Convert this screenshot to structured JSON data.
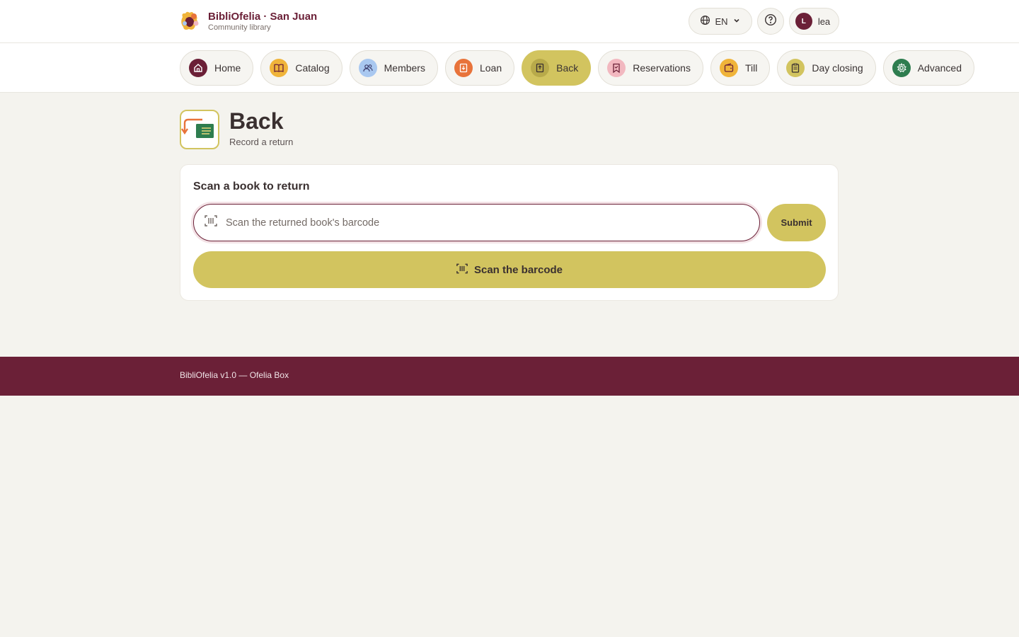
{
  "header": {
    "brand_title": "BibliOfelia · San Juan",
    "brand_subtitle": "Community library",
    "language": "EN",
    "user_initial": "L",
    "user_name": "lea"
  },
  "nav": {
    "items": [
      {
        "label": "Home",
        "icon": "home-icon",
        "color": "#6b2037"
      },
      {
        "label": "Catalog",
        "icon": "book-icon",
        "color": "#f0b43a"
      },
      {
        "label": "Members",
        "icon": "users-icon",
        "color": "#a9c8f0"
      },
      {
        "label": "Loan",
        "icon": "loan-icon",
        "color": "#e8733a"
      },
      {
        "label": "Back",
        "icon": "return-icon",
        "color": "#b8aa4a",
        "active": true
      },
      {
        "label": "Reservations",
        "icon": "bookmark-icon",
        "color": "#f2b8c0"
      },
      {
        "label": "Till",
        "icon": "wallet-icon",
        "color": "#f0b43a"
      },
      {
        "label": "Day closing",
        "icon": "clipboard-icon",
        "color": "#d2c45f"
      },
      {
        "label": "Advanced",
        "icon": "gear-icon",
        "color": "#2e7d4f"
      }
    ]
  },
  "page": {
    "title": "Back",
    "subtitle": "Record a return"
  },
  "card": {
    "title": "Scan a book to return",
    "input_placeholder": "Scan the returned book's barcode",
    "input_value": "",
    "submit_label": "Submit",
    "scan_label": "Scan the barcode"
  },
  "footer": {
    "text": "BibliOfelia v1.0 — Ofelia Box"
  },
  "colors": {
    "brand": "#6b2037",
    "accent": "#d2c45f",
    "background": "#f4f3ee"
  }
}
